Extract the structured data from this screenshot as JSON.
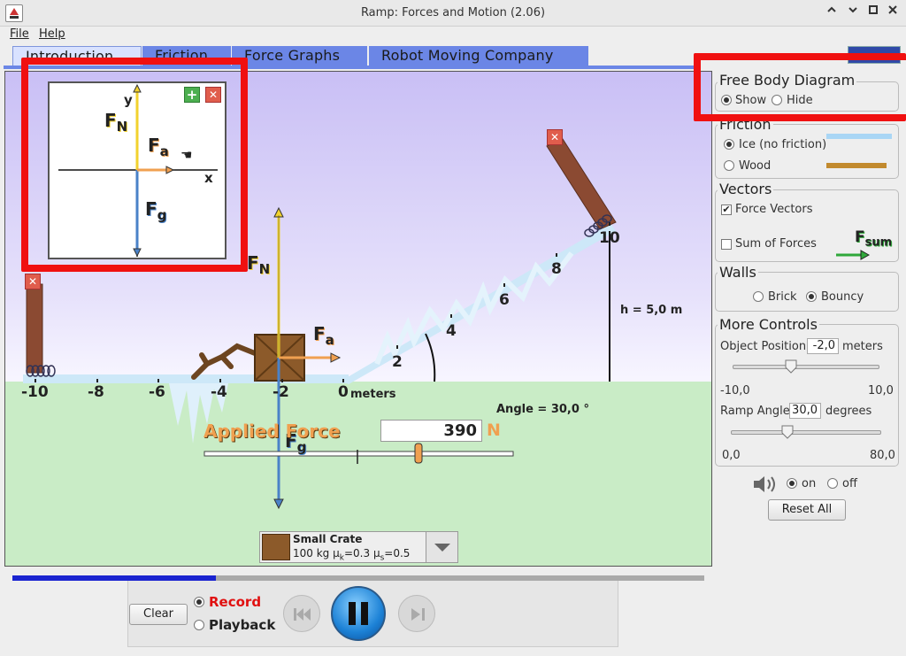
{
  "window": {
    "title": "Ramp: Forces and Motion (2.06)",
    "minimize_icon": "chevron-up",
    "restore_icon": "chevron-down",
    "maximize_icon": "square",
    "close_icon": "x"
  },
  "menu": {
    "file": "File",
    "help": "Help"
  },
  "tabs": [
    "Introduction",
    "Friction",
    "Force Graphs",
    "Robot Moving Company"
  ],
  "fbd": {
    "y": "y",
    "x": "x",
    "fn": "F",
    "fn_sub": "N",
    "fa": "F",
    "fa_sub": "a",
    "fg": "F",
    "fg_sub": "g"
  },
  "scene": {
    "axis_labels": [
      "-10",
      "-8",
      "-6",
      "-4",
      "-2",
      "0"
    ],
    "meters": "meters",
    "ramp_labels": [
      "2",
      "4",
      "6",
      "8",
      "10"
    ],
    "height": "h = 5,0 m",
    "angle": "Angle = 30,0 °",
    "fn": "F",
    "fn_sub": "N",
    "fa": "F",
    "fa_sub": "a",
    "fg": "F",
    "fg_sub": "g",
    "applied_force_label": "Applied Force",
    "applied_force_value": "390",
    "applied_force_unit": "N",
    "applied_force_slider_level": 0.69
  },
  "object_select": {
    "name": "Small Crate",
    "mass": "100 kg",
    "mu_k_label": "μ",
    "mu_k_sub": "k",
    "mu_k_val": "=0.3",
    "mu_s_label": "μ",
    "mu_s_sub": "s",
    "mu_s_val": "=0.5"
  },
  "panel": {
    "fbd_title": "Free Body Diagram",
    "show": "Show",
    "hide": "Hide",
    "friction_title": "Friction",
    "ice": "Ice (no friction)",
    "wood": "Wood",
    "vectors_title": "Vectors",
    "force_vectors": "Force Vectors",
    "sum_of_forces": "Sum of Forces",
    "fsum": "F",
    "fsum_sub": "sum",
    "walls_title": "Walls",
    "brick": "Brick",
    "bouncy": "Bouncy",
    "more_title": "More Controls",
    "object_position": "Object Position",
    "object_position_value": "-2,0",
    "meters": "meters",
    "pos_min": "-10,0",
    "pos_max": "10,0",
    "pos_level": 0.4,
    "ramp_angle": "Ramp Angle",
    "ramp_angle_value": "30,0",
    "degrees": "degrees",
    "ang_min": "0,0",
    "ang_max": "80,0",
    "ang_level": 0.375,
    "sound_on": "on",
    "sound_off": "off",
    "reset": "Reset All"
  },
  "playback": {
    "clear": "Clear",
    "record": "Record",
    "playback": "Playback",
    "progress": 0.294
  },
  "colors": {
    "fn": "#f2d22e",
    "fa": "#f0a050",
    "fg": "#4a82c8",
    "record": "#e01010",
    "highlight": "#f01010"
  }
}
